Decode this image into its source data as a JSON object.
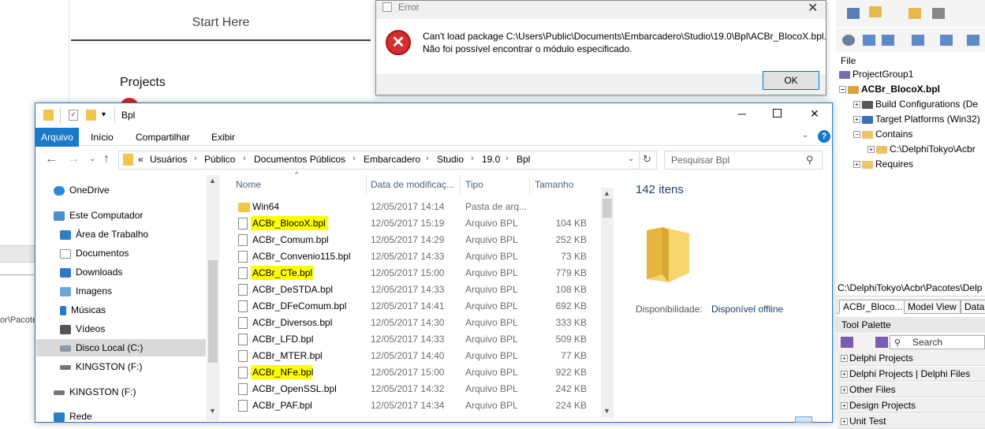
{
  "ide": {
    "start_tab": "Start Here",
    "projects_heading": "Projects",
    "left_path": "or\\Pacotes"
  },
  "right_panel": {
    "file_label": "File",
    "tree": [
      "ProjectGroup1",
      "ACBr_BlocoX.bpl",
      "Build Configurations (De",
      "Target Platforms (Win32)",
      "Contains",
      "C:\\DelphiTokyo\\Acbr",
      "Requires"
    ],
    "path": "C:\\DelphiTokyo\\Acbr\\Pacotes\\Delp",
    "tabs": [
      "ACBr_Bloco...",
      "Model View",
      "Data"
    ],
    "palette_title": "Tool Palette",
    "search_placeholder": "Search",
    "categories": [
      "Delphi Projects",
      "Delphi Projects | Delphi Files",
      "Other Files",
      "Design Projects",
      "Unit Test"
    ]
  },
  "error_dialog": {
    "title": "Error",
    "message_line1": "Can't load package C:\\Users\\Public\\Documents\\Embarcadero\\Studio\\19.0\\Bpl\\ACBr_BlocoX.bpl.",
    "message_line2": "Não foi possível encontrar o módulo especificado.",
    "ok_label": "OK"
  },
  "explorer": {
    "title": "Bpl",
    "ribbon_tabs": [
      "Arquivo",
      "Início",
      "Compartilhar",
      "Exibir"
    ],
    "breadcrumb": [
      "«",
      "Usuários",
      "Público",
      "Documentos Públicos",
      "Embarcadero",
      "Studio",
      "19.0",
      "Bpl"
    ],
    "search_placeholder": "Pesquisar Bpl",
    "nav_items": [
      "OneDrive",
      "Este Computador",
      "Área de Trabalho",
      "Documentos",
      "Downloads",
      "Imagens",
      "Músicas",
      "Vídeos",
      "Disco Local (C:)",
      "KINGSTON (F:)",
      "KINGSTON (F:)",
      "Rede"
    ],
    "columns": [
      "Nome",
      "Data de modificaç...",
      "Tipo",
      "Tamanho"
    ],
    "files": [
      {
        "name": "Win64",
        "date": "12/05/2017 14:14",
        "type": "Pasta de arq...",
        "size": "",
        "folder": true,
        "highlight": false
      },
      {
        "name": "ACBr_BlocoX.bpl",
        "date": "12/05/2017 15:19",
        "type": "Arquivo BPL",
        "size": "104 KB",
        "folder": false,
        "highlight": true
      },
      {
        "name": "ACBr_Comum.bpl",
        "date": "12/05/2017 14:29",
        "type": "Arquivo BPL",
        "size": "252 KB",
        "folder": false,
        "highlight": false
      },
      {
        "name": "ACBr_Convenio115.bpl",
        "date": "12/05/2017 14:33",
        "type": "Arquivo BPL",
        "size": "73 KB",
        "folder": false,
        "highlight": false
      },
      {
        "name": "ACBr_CTe.bpl",
        "date": "12/05/2017 15:00",
        "type": "Arquivo BPL",
        "size": "779 KB",
        "folder": false,
        "highlight": true
      },
      {
        "name": "ACBr_DeSTDA.bpl",
        "date": "12/05/2017 14:33",
        "type": "Arquivo BPL",
        "size": "108 KB",
        "folder": false,
        "highlight": false
      },
      {
        "name": "ACBr_DFeComum.bpl",
        "date": "12/05/2017 14:41",
        "type": "Arquivo BPL",
        "size": "692 KB",
        "folder": false,
        "highlight": false
      },
      {
        "name": "ACBr_Diversos.bpl",
        "date": "12/05/2017 14:30",
        "type": "Arquivo BPL",
        "size": "333 KB",
        "folder": false,
        "highlight": false
      },
      {
        "name": "ACBr_LFD.bpl",
        "date": "12/05/2017 14:33",
        "type": "Arquivo BPL",
        "size": "509 KB",
        "folder": false,
        "highlight": false
      },
      {
        "name": "ACBr_MTER.bpl",
        "date": "12/05/2017 14:40",
        "type": "Arquivo BPL",
        "size": "77 KB",
        "folder": false,
        "highlight": false
      },
      {
        "name": "ACBr_NFe.bpl",
        "date": "12/05/2017 15:00",
        "type": "Arquivo BPL",
        "size": "922 KB",
        "folder": false,
        "highlight": true
      },
      {
        "name": "ACBr_OpenSSL.bpl",
        "date": "12/05/2017 14:32",
        "type": "Arquivo BPL",
        "size": "242 KB",
        "folder": false,
        "highlight": false
      },
      {
        "name": "ACBr_PAF.bpl",
        "date": "12/05/2017 14:34",
        "type": "Arquivo BPL",
        "size": "224 KB",
        "folder": false,
        "highlight": false
      }
    ],
    "item_count": "142 itens",
    "availability_label": "Disponibilidade:",
    "availability_value": "Disponível offline"
  }
}
